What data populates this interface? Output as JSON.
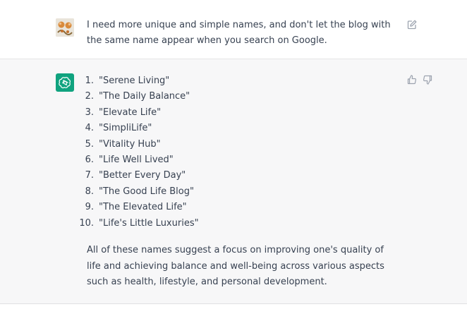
{
  "user_message": {
    "text": "I need more unique and simple names, and don't let the blog with the same name appear when you search on Google."
  },
  "assistant_message": {
    "names": [
      {
        "number": "1.",
        "name": "\"Serene Living\""
      },
      {
        "number": "2.",
        "name": "\"The Daily Balance\""
      },
      {
        "number": "3.",
        "name": "\"Elevate Life\""
      },
      {
        "number": "4.",
        "name": "\"SimpliLife\""
      },
      {
        "number": "5.",
        "name": "\"Vitality Hub\""
      },
      {
        "number": "6.",
        "name": "\"Life Well Lived\""
      },
      {
        "number": "7.",
        "name": "\"Better Every Day\""
      },
      {
        "number": "8.",
        "name": "\"The Good Life Blog\""
      },
      {
        "number": "9.",
        "name": "\"The Elevated Life\""
      },
      {
        "number": "10.",
        "name": "\"Life's Little Luxuries\""
      }
    ],
    "summary": "All of these names suggest a focus on improving one's quality of life and achieving balance and well-being across various aspects such as health, lifestyle, and personal development."
  },
  "icons": {
    "user_avatar": "user-avatar",
    "edit": "edit-icon",
    "assistant_logo": "openai-logo-icon",
    "thumbs_up": "thumbs-up-icon",
    "thumbs_down": "thumbs-down-icon"
  },
  "colors": {
    "assistant_bg": "#f7f7f8",
    "user_bg": "#ffffff",
    "brand_green": "#10a37f",
    "text": "#374151",
    "icon_gray": "#9ca3af"
  }
}
